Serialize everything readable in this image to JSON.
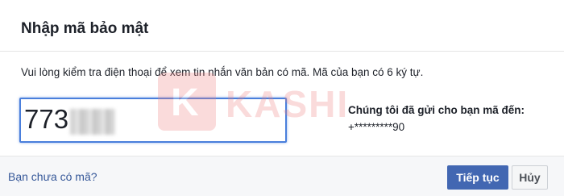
{
  "dialog": {
    "title": "Nhập mã bảo mật",
    "instructions": "Vui lòng kiểm tra điện thoại để xem tin nhắn văn bản có mã. Mã của bạn có 6 ký tự.",
    "code_input": {
      "value_visible": "773",
      "obscured": true
    },
    "sent_to": {
      "label": "Chúng tôi đã gửi cho bạn mã đến:",
      "number": "+*********90"
    }
  },
  "footer": {
    "no_code_link": "Bạn chưa có mã?",
    "continue_label": "Tiếp tục",
    "cancel_label": "Hủy"
  },
  "watermark": {
    "letter": "K",
    "text": "KASHI"
  },
  "colors": {
    "primary_button": "#4267b2",
    "link": "#365899",
    "input_focus_border": "#4a7fdc",
    "footer_bg": "#f6f7f9",
    "watermark": "#f08080"
  }
}
